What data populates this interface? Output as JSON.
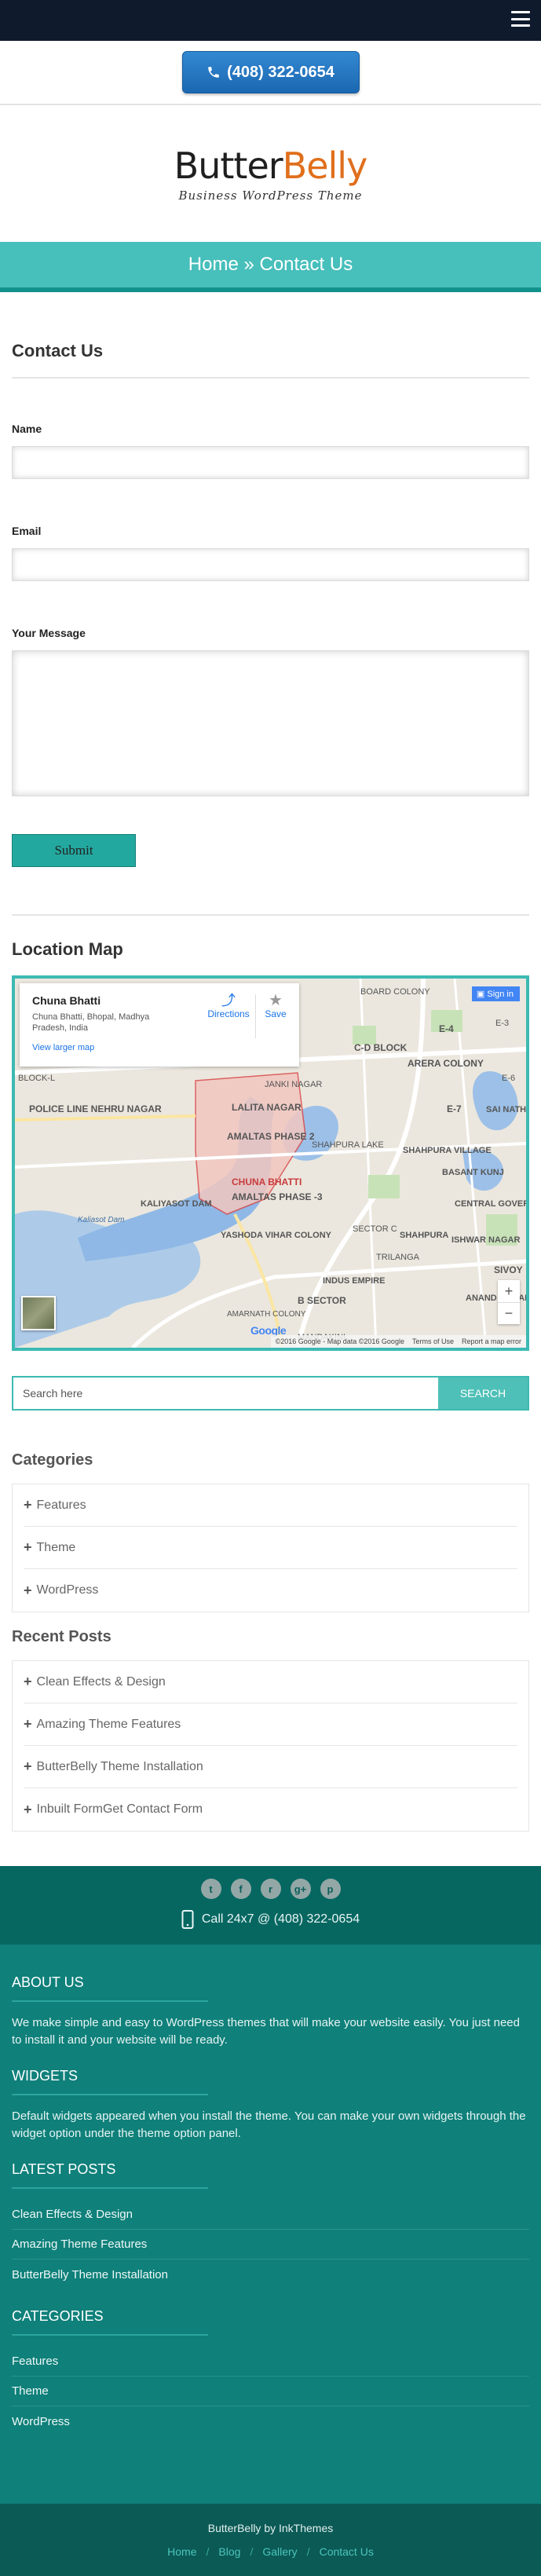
{
  "header": {
    "menu_icon": "hamburger-icon",
    "phone_label": "(408) 322-0654",
    "phone_icon": "phone-icon"
  },
  "logo": {
    "part1": "Butter",
    "part2": "Belly",
    "tagline": "Business WordPress Theme",
    "colors": {
      "dark": "#1f1f1f",
      "orange": "#e06f1c"
    }
  },
  "breadcrumb": {
    "text": "Home » Contact Us"
  },
  "contact": {
    "title": "Contact Us",
    "name_label": "Name",
    "email_label": "Email",
    "message_label": "Your Message",
    "submit_label": "Submit"
  },
  "map": {
    "title": "Location Map",
    "place_name": "Chuna Bhatti",
    "address": "Chuna Bhatti, Bhopal, Madhya Pradesh, India",
    "view_larger": "View larger map",
    "directions": "Directions",
    "save": "Save",
    "sign_in": "Sign in",
    "zoom_in": "+",
    "zoom_out": "−",
    "google": "Google",
    "copyright": "©2016 Google - Map data ©2016 Google",
    "terms": "Terms of Use",
    "report": "Report a map error",
    "labels": {
      "lalita": "LALITA NAGAR",
      "janki": "JANKI NAGAR",
      "amaltas2": "AMALTAS PHASE 2",
      "chuna": "CHUNA BHATTI",
      "amaltas3": "AMALTAS PHASE -3",
      "shahpura_lake": "SHAHPURA LAKE",
      "kaliyasot": "KALIYASOT DAM",
      "yashoda": "YASHODA VIHAR COLONY",
      "police": "POLICE LINE NEHRU NAGAR",
      "blockl": "BLOCK-L",
      "board": "BOARD COLONY",
      "cd": "C-D BLOCK",
      "e4": "E-4",
      "arera": "ARERA COLONY",
      "e7": "E-7",
      "sainath": "SAI NATH NAGAR",
      "shahpura_village": "SHAHPURA VILLAGE",
      "basant": "BASANT KUNJ",
      "central": "CENTRAL GOVERNMENT COLONY",
      "ishwar": "ISHWAR NAGAR",
      "sector_c": "SECTOR C",
      "trilanga": "TRILANGA",
      "shahpura": "SHAHPURA",
      "indus": "INDUS EMPIRE",
      "bsector": "B SECTOR",
      "amarnath": "AMARNATH COLONY",
      "mandakini": "MANDAKINI",
      "sivoy": "SIVOY",
      "anand": "ANAND NAGAR",
      "e3": "E-3",
      "e6": "E-6",
      "kaliyasot_river": "Kaliasot Dam"
    }
  },
  "search": {
    "placeholder": "Search here",
    "button": "SEARCH"
  },
  "categories": {
    "title": "Categories",
    "items": [
      "Features",
      "Theme",
      "WordPress"
    ]
  },
  "recent_posts": {
    "title": "Recent Posts",
    "items": [
      "Clean Effects & Design",
      "Amazing Theme Features",
      "ButterBelly Theme Installation",
      "Inbuilt FormGet Contact Form"
    ]
  },
  "footer": {
    "socials": [
      "twitter-icon",
      "facebook-icon",
      "rss-icon",
      "google-plus-icon",
      "pinterest-icon"
    ],
    "social_glyphs": [
      "t",
      "f",
      "r",
      "g+",
      "p"
    ],
    "call_text": "Call 24x7 @ (408) 322-0654",
    "about_title": "ABOUT US",
    "about_text": "We make simple and easy to WordPress themes that will make your website easily. You just need to install it and your website will be ready.",
    "widgets_title": "WIDGETS",
    "widgets_text": "Default widgets appeared when you install the theme. You can make your own widgets through the widget option under the theme option panel.",
    "latest_title": "LATEST POSTS",
    "latest_items": [
      "Clean Effects & Design",
      "Amazing Theme Features",
      "ButterBelly Theme Installation"
    ],
    "categories_title": "CATEGORIES",
    "category_items": [
      "Features",
      "Theme",
      "WordPress"
    ]
  },
  "bottom": {
    "credit": "ButterBelly by InkThemes",
    "links": [
      "Home",
      "Blog",
      "Gallery",
      "Contact Us"
    ],
    "separator": "/"
  }
}
